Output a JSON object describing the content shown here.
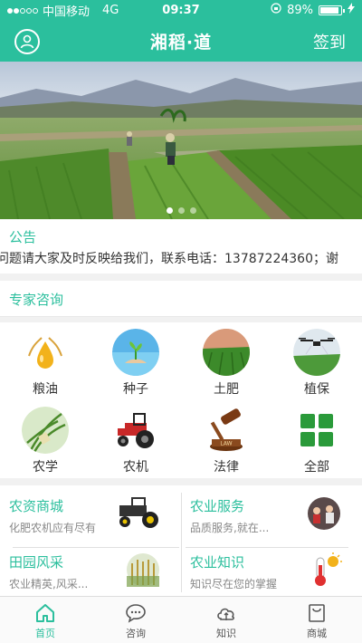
{
  "status_bar": {
    "carrier": "中国移动",
    "network": "4G",
    "time": "09:37",
    "battery_percent": "89%",
    "battery_level": 0.89
  },
  "header": {
    "title": "湘稻·道",
    "signin_label": "签到"
  },
  "banner": {
    "page_count": 3,
    "active_page": 0
  },
  "notice": {
    "label": "公告",
    "text": "问题请大家及时反映给我们，联系电话：13787224360；谢"
  },
  "expert": {
    "title": "专家咨询"
  },
  "categories": [
    {
      "label": "粮油"
    },
    {
      "label": "种子"
    },
    {
      "label": "土肥"
    },
    {
      "label": "植保"
    },
    {
      "label": "农学"
    },
    {
      "label": "农机"
    },
    {
      "label": "法律"
    },
    {
      "label": "全部"
    }
  ],
  "cards": [
    {
      "title": "农资商城",
      "subtitle": "化肥农机应有尽有"
    },
    {
      "title": "农业服务",
      "subtitle": "品质服务,就在..."
    },
    {
      "title": "田园风采",
      "subtitle": "农业精英,风采..."
    },
    {
      "title": "农业知识",
      "subtitle": "知识尽在您的掌握"
    }
  ],
  "tabs": [
    {
      "label": "首页",
      "icon": "home-icon"
    },
    {
      "label": "咨询",
      "icon": "chat-icon"
    },
    {
      "label": "知识",
      "icon": "knowledge-icon"
    },
    {
      "label": "商城",
      "icon": "shop-icon"
    }
  ],
  "colors": {
    "accent": "#2bbf9d"
  }
}
